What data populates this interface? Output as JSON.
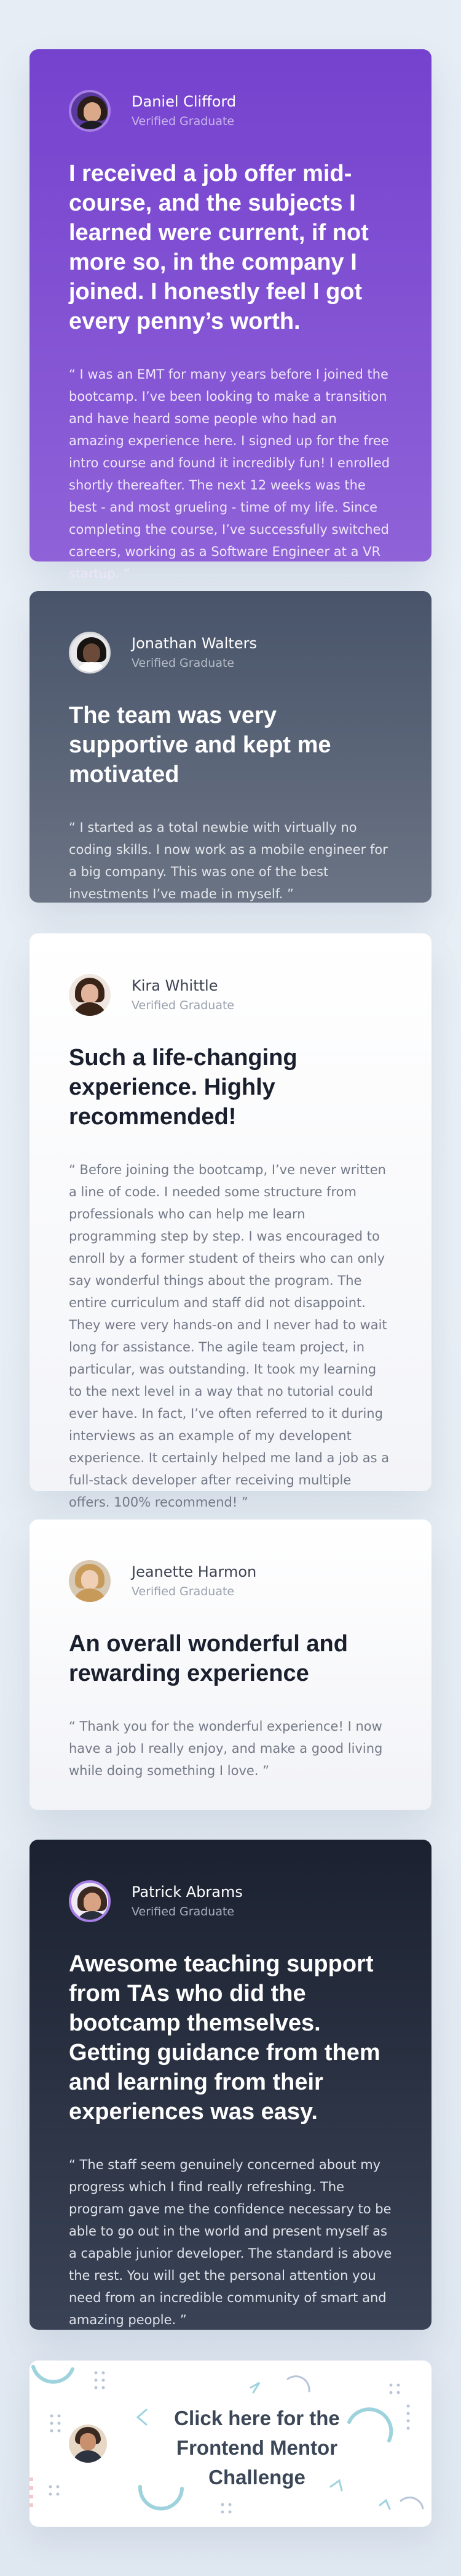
{
  "testimonials": [
    {
      "name": "Daniel Clifford",
      "role": "Verified Graduate",
      "avatar_icon": "avatar-portrait",
      "headline": "I received a job offer mid-course, and the subjects I learned were current, if not more so, in the company I joined. I honestly feel I got every penny’s worth.",
      "quote": "“ I was an EMT for many years before I joined the bootcamp. I’ve been looking to make a transition and have heard some people who had an amazing experience here. I signed up for the free intro course and found it incredibly fun! I enrolled shortly thereafter. The next 12 weeks was the best - and most grueling - time of my life. Since completing the course, I’ve successfully switched careers, working as a Software Engineer at a VR startup. ”",
      "background": "#7542ce"
    },
    {
      "name": "Jonathan Walters",
      "role": "Verified Graduate",
      "avatar_icon": "avatar-portrait",
      "headline": "The team was very supportive and kept me motivated",
      "quote": "“ I started as a total newbie with virtually no coding skills. I now work as a mobile engineer for a big company. This was one of the best investments I’ve made in myself. ”",
      "background": "#48546a"
    },
    {
      "name": "Kira Whittle",
      "role": "Verified Graduate",
      "avatar_icon": "avatar-portrait",
      "headline": "Such a life-changing experience. Highly recommended!",
      "quote": "“ Before joining the bootcamp, I’ve never written a line of code. I needed some structure from professionals who can help me learn programming step by step. I was encouraged to enroll by a former student of theirs who can only say wonderful things about the program. The entire curriculum and staff did not disappoint. They were very hands-on and I never had to wait long for assistance. The agile team project, in particular, was outstanding. It took my learning to the next level in a way that no tutorial could ever have. In fact, I’ve often referred to it during interviews as an example of my developent experience. It certainly helped me land a job as a full-stack developer after receiving multiple offers. 100% recommend! ”",
      "background": "#ffffff"
    },
    {
      "name": "Jeanette Harmon",
      "role": "Verified Graduate",
      "avatar_icon": "avatar-portrait",
      "headline": "An overall wonderful and rewarding experience",
      "quote": "“ Thank you for the wonderful experience! I now have a job I really enjoy, and make a good living while doing something I love. ”",
      "background": "#ffffff"
    },
    {
      "name": "Patrick Abrams",
      "role": "Verified Graduate",
      "avatar_icon": "avatar-portrait",
      "headline": "Awesome teaching support from TAs who did the bootcamp themselves. Getting guidance from them and learning from their experiences was easy.",
      "quote": "“ The staff seem genuinely concerned about my progress which I find really refreshing. The program gave me the confidence necessary to be able to go out in the world and present myself as a capable junior developer. The standard is above the rest. You will get the personal attention you need from an incredible community of smart and amazing people. ”",
      "background": "#1b2130"
    }
  ],
  "attribution": {
    "link_text": "Click here for the Frontend Mentor Challenge",
    "avatar_icon": "avatar-portrait",
    "accent": "#9ed3dd"
  }
}
